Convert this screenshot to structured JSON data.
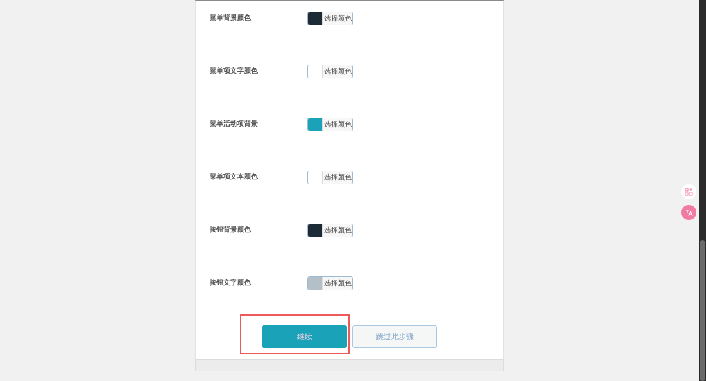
{
  "color_settings": [
    {
      "label": "菜单背景颜色",
      "color": "#1c2b36",
      "button": "选择颜色"
    },
    {
      "label": "菜单项文字颜色",
      "color": "#ffffff",
      "button": "选择颜色"
    },
    {
      "label": "菜单活动项背景",
      "color": "#1aa3b8",
      "button": "选择颜色"
    },
    {
      "label": "菜单项文本颜色",
      "color": "#ffffff",
      "button": "选择颜色"
    },
    {
      "label": "按钮背景颜色",
      "color": "#1c2b36",
      "button": "选择颜色"
    },
    {
      "label": "按钮文字颜色",
      "color": "#b4c0c8",
      "button": "选择颜色"
    }
  ],
  "actions": {
    "primary": "继续",
    "secondary": "跳过此步骤",
    "highlighted": true
  }
}
